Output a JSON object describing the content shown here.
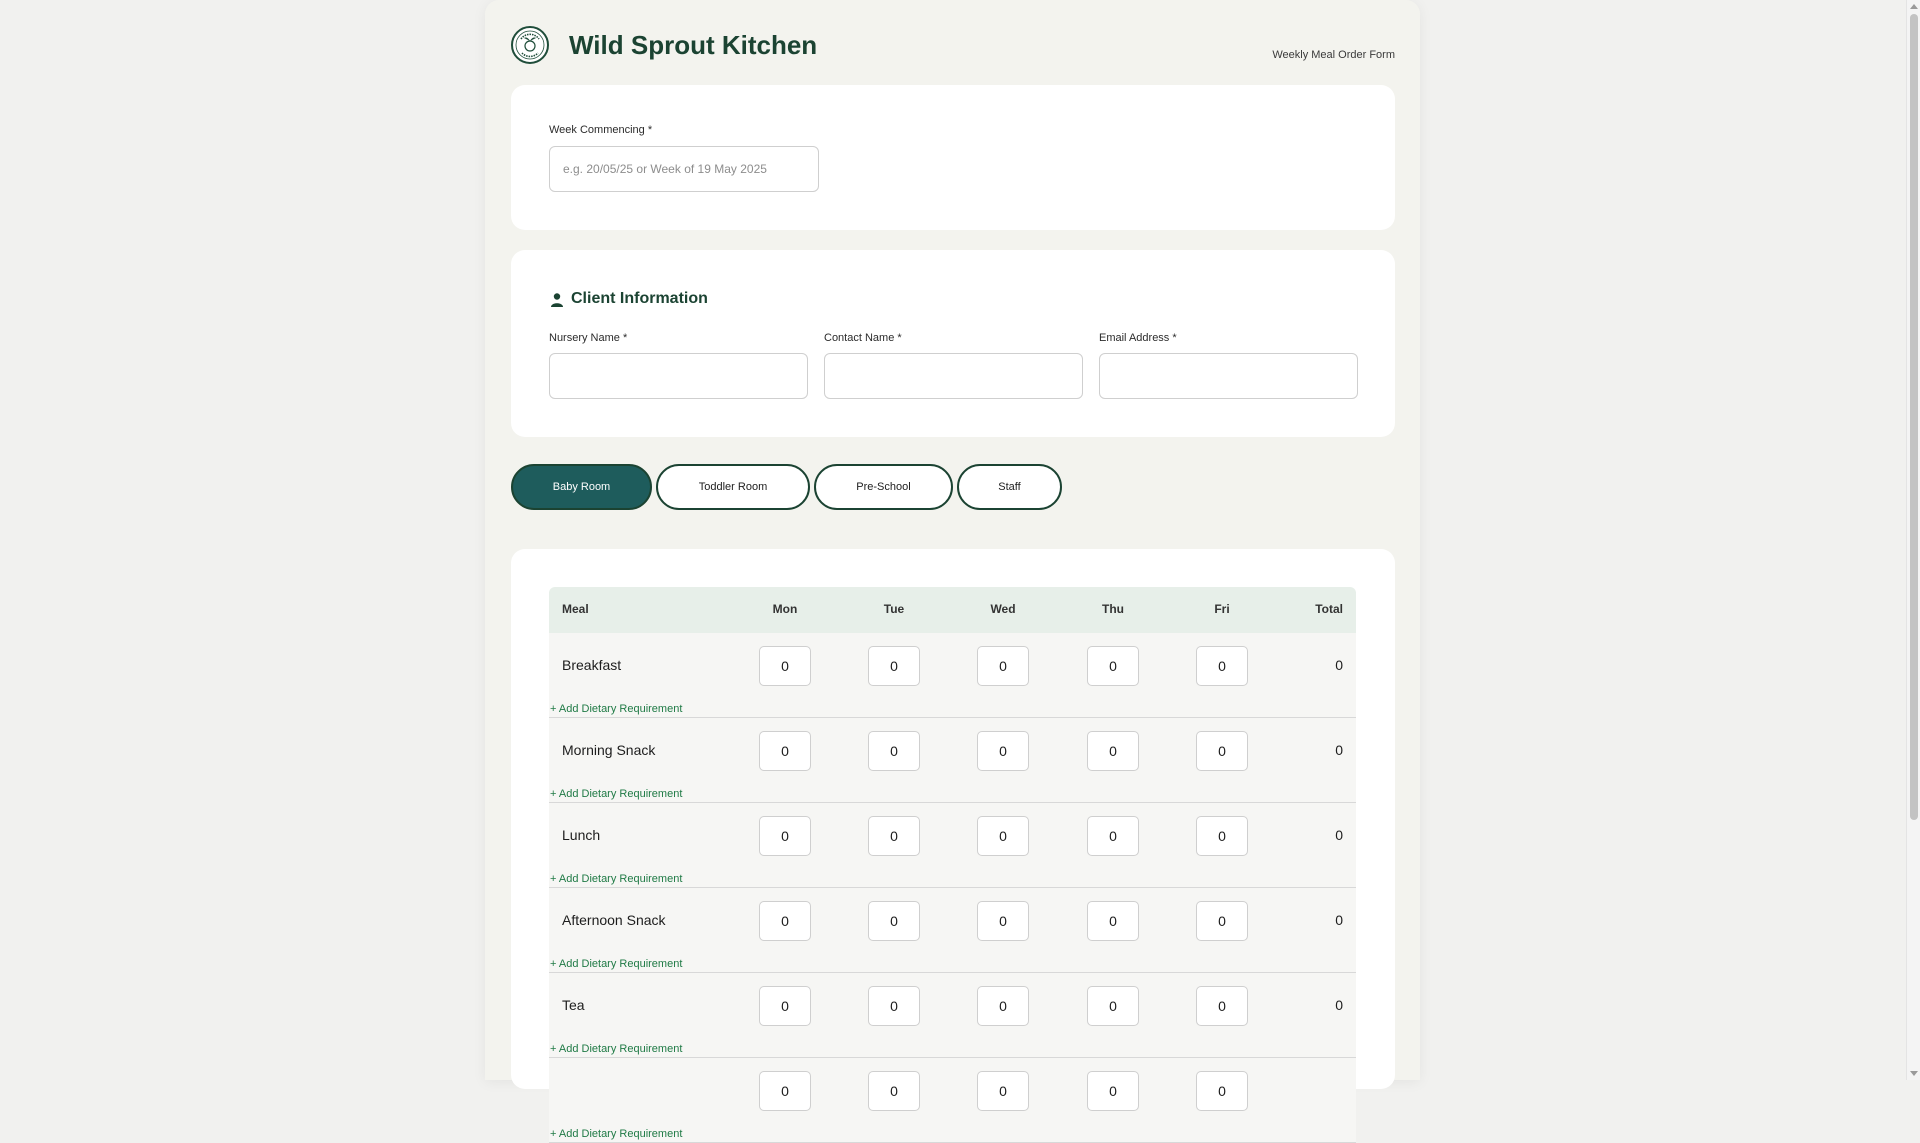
{
  "header": {
    "brand": "Wild Sprout Kitchen",
    "form_name": "Weekly Meal Order Form",
    "logo_icon": "wild-sprout-logo-icon"
  },
  "week": {
    "label": "Week Commencing *",
    "placeholder": "e.g. 20/05/25 or Week of 19 May 2025",
    "value": ""
  },
  "client": {
    "title": "Client Information",
    "icon": "person-icon",
    "fields": [
      {
        "label": "Nursery Name *",
        "value": ""
      },
      {
        "label": "Contact Name *",
        "value": ""
      },
      {
        "label": "Email Address *",
        "value": ""
      }
    ]
  },
  "rooms": {
    "tabs": [
      "Baby Room",
      "Toddler Room",
      "Pre-School",
      "Staff"
    ],
    "active": "Baby Room"
  },
  "table": {
    "headers": [
      "Meal",
      "Mon",
      "Tue",
      "Wed",
      "Thu",
      "Fri",
      "Total"
    ],
    "add_dietary_label": "+ Add Dietary Requirement",
    "rows": [
      {
        "meal": "Breakfast",
        "mon": "0",
        "tue": "0",
        "wed": "0",
        "thu": "0",
        "fri": "0",
        "total": "0"
      },
      {
        "meal": "Morning Snack",
        "mon": "0",
        "tue": "0",
        "wed": "0",
        "thu": "0",
        "fri": "0",
        "total": "0"
      },
      {
        "meal": "Lunch",
        "mon": "0",
        "tue": "0",
        "wed": "0",
        "thu": "0",
        "fri": "0",
        "total": "0"
      },
      {
        "meal": "Afternoon Snack",
        "mon": "0",
        "tue": "0",
        "wed": "0",
        "thu": "0",
        "fri": "0",
        "total": "0"
      },
      {
        "meal": "Tea",
        "mon": "0",
        "tue": "0",
        "wed": "0",
        "thu": "0",
        "fri": "0",
        "total": "0"
      },
      {
        "meal": "",
        "mon": "0",
        "tue": "0",
        "wed": "0",
        "thu": "0",
        "fri": "0",
        "total": ""
      }
    ]
  },
  "colors": {
    "brand_green": "#1b4332",
    "active_tab": "#1e5c5c",
    "link_green": "#1f7a45",
    "table_header_bg": "#e7efe9"
  }
}
